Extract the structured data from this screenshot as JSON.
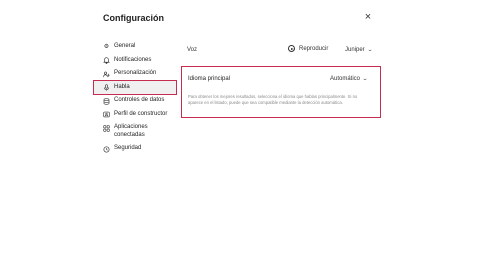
{
  "dialog": {
    "title": "Configuración",
    "close_glyph": "×"
  },
  "nav": {
    "items": [
      {
        "label": "General",
        "icon": "gear-icon",
        "glyph": "⚙"
      },
      {
        "label": "Notificaciones",
        "icon": "bell-icon",
        "glyph": "🔔"
      },
      {
        "label": "Personalización",
        "icon": "personalize-icon",
        "glyph": "⚇"
      },
      {
        "label": "Habla",
        "icon": "microphone-icon",
        "glyph": "🎙",
        "active": true
      },
      {
        "label": "Controles de datos",
        "icon": "database-icon",
        "glyph": "⛁"
      },
      {
        "label": "Perfil de constructor",
        "icon": "user-card-icon",
        "glyph": "▣"
      },
      {
        "label": "Aplicaciones conectadas",
        "icon": "apps-icon",
        "glyph": "⚏"
      },
      {
        "label": "Seguridad",
        "icon": "shield-icon",
        "glyph": "⛨"
      }
    ]
  },
  "speech": {
    "voice_label": "Voz",
    "play_label": "Reproducir",
    "voice_value": "Juniper",
    "language_label": "Idioma principal",
    "language_value": "Automático",
    "language_description": "Para obtener los mejores resultados, selecciona el idioma que hablas principalmente. Si no aparece en el listado, puede que sea compatible mediante la detección automática."
  }
}
